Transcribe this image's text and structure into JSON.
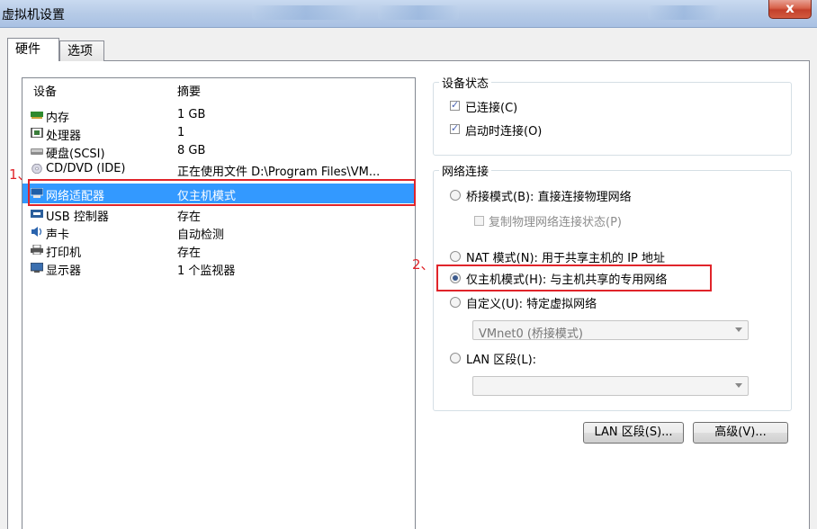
{
  "window": {
    "title": "虚拟机设置",
    "close_label": "x"
  },
  "tabs": [
    {
      "label": "硬件"
    },
    {
      "label": "选项"
    }
  ],
  "device_list": {
    "headers": {
      "device": "设备",
      "summary": "摘要"
    },
    "rows": [
      {
        "name": "内存",
        "summary": "1 GB",
        "icon": "memory-icon"
      },
      {
        "name": "处理器",
        "summary": "1",
        "icon": "processor-icon"
      },
      {
        "name": "硬盘(SCSI)",
        "summary": "8 GB",
        "icon": "harddisk-icon"
      },
      {
        "name": "CD/DVD (IDE)",
        "summary": "正在使用文件 D:\\Program Files\\VM...",
        "icon": "cd-icon"
      },
      {
        "name": "网络适配器",
        "summary": "仅主机模式",
        "icon": "network-adapter-icon",
        "selected": true
      },
      {
        "name": "USB 控制器",
        "summary": "存在",
        "icon": "usb-icon"
      },
      {
        "name": "声卡",
        "summary": "自动检测",
        "icon": "sound-icon"
      },
      {
        "name": "打印机",
        "summary": "存在",
        "icon": "printer-icon"
      },
      {
        "name": "显示器",
        "summary": "1 个监视器",
        "icon": "display-icon"
      }
    ]
  },
  "annotations": {
    "marker1": "1、",
    "marker2": "2、",
    "highlight_color": "#e0242a"
  },
  "device_status": {
    "title": "设备状态",
    "connected": {
      "label": "已连接(C)",
      "checked": true
    },
    "connect_at_power_on": {
      "label": "启动时连接(O)",
      "checked": true
    }
  },
  "network_connection": {
    "title": "网络连接",
    "bridged": {
      "label": "桥接模式(B): 直接连接物理网络",
      "selected": false
    },
    "replicate": {
      "label": "复制物理网络连接状态(P)",
      "checked": false,
      "disabled": true
    },
    "nat": {
      "label": "NAT 模式(N): 用于共享主机的 IP 地址",
      "selected": false
    },
    "host_only": {
      "label": "仅主机模式(H): 与主机共享的专用网络",
      "selected": true
    },
    "custom": {
      "label": "自定义(U): 特定虚拟网络",
      "selected": false
    },
    "custom_select_value": "VMnet0 (桥接模式)",
    "lan_segment": {
      "label": "LAN 区段(L):",
      "selected": false
    },
    "lan_select_value": ""
  },
  "buttons": {
    "lan_segments": "LAN 区段(S)...",
    "advanced": "高级(V)..."
  },
  "colors": {
    "selection": "#3399ff",
    "title_bar": "#b6cbe7"
  }
}
